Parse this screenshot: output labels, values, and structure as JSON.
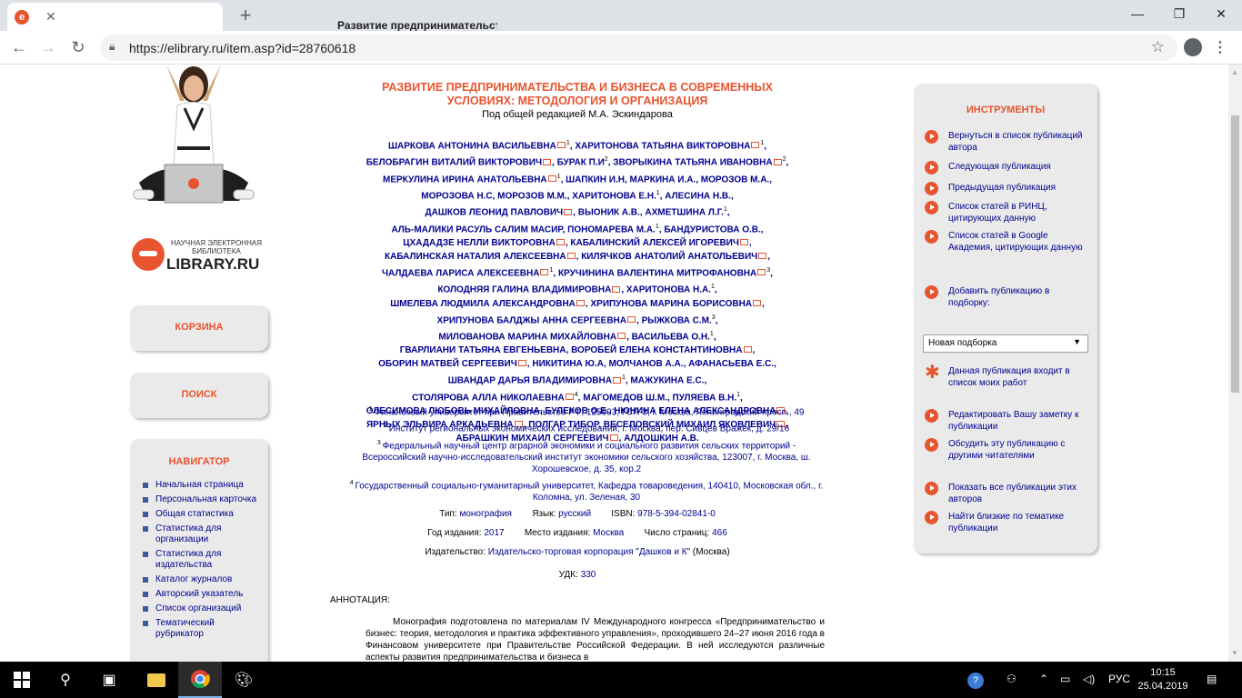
{
  "browser": {
    "tab_title": "Развитие предпринимательства",
    "url": "https://elibrary.ru/item.asp?id=28760618"
  },
  "logo": {
    "line1": "НАУЧНАЯ ЭЛЕКТРОННАЯ",
    "line2": "БИБЛИОТЕКА",
    "brand": "LIBRARY.RU"
  },
  "sidebar": {
    "cart": "КОРЗИНА",
    "search": "ПОИСК",
    "navigator": "НАВИГАТОР",
    "nav_items": [
      "Начальная страница",
      "Персональная карточка",
      "Общая статистика",
      "Статистика для организации",
      "Статистика для издательства",
      "Каталог журналов",
      "Авторский указатель",
      "Список организаций",
      "Тематический рубрикатор"
    ]
  },
  "article": {
    "title_line1": "РАЗВИТИЕ ПРЕДПРИНИМАТЕЛЬСТВА И БИЗНЕСА В СОВРЕМЕННЫХ",
    "title_line2": "УСЛОВИЯХ: МЕТОДОЛОГИЯ И ОРГАНИЗАЦИЯ",
    "editor": "Под общей редакцией М.А. Эскиндарова",
    "authors": [
      [
        "ШАРКОВА АНТОНИНА ВАСИЛЬЕВНА",
        "1",
        true
      ],
      [
        "ХАРИТОНОВА ТАТЬЯНА ВИКТОРОВНА",
        "1",
        true
      ],
      [
        "БЕЛОБРАГИН ВИТАЛИЙ ВИКТОРОВИЧ",
        "",
        true
      ],
      [
        "БУРАК П.И",
        "2",
        false
      ],
      [
        "ЗВОРЫКИНА ТАТЬЯНА ИВАНОВНА",
        "2",
        true
      ],
      [
        "МЕРКУЛИНА ИРИНА АНАТОЛЬЕВНА",
        "1",
        true
      ],
      [
        "ШАПКИН И.Н",
        "",
        false
      ],
      [
        "МАРКИНА И.А.",
        "",
        false
      ],
      [
        "МОРОЗОВ М.А.",
        "",
        false
      ],
      [
        "МОРОЗОВА Н.С",
        "",
        false
      ],
      [
        "МОРОЗОВ М.М.",
        "",
        false
      ],
      [
        "ХАРИТОНОВА Е.Н.",
        "1",
        false
      ],
      [
        "АЛЕСИНА Н.В.",
        "",
        false
      ],
      [
        "ДАШКОВ ЛЕОНИД ПАВЛОВИЧ",
        "",
        true
      ],
      [
        "ВЫОНИК А.В.",
        "",
        false
      ],
      [
        "АХМЕТШИНА Л.Г.",
        "1",
        false
      ],
      [
        "АЛЬ-МАЛИКИ РАСУЛЬ САЛИМ МАСИР",
        "",
        false
      ],
      [
        "ПОНОМАРЕВА М.А.",
        "1",
        false
      ],
      [
        "БАНДУРИСТОВА О.В.",
        "",
        false
      ],
      [
        "ЦХАДАДЗЕ НЕЛЛИ ВИКТОРОВНА",
        "",
        true
      ],
      [
        "КАБАЛИНСКИЙ АЛЕКСЕЙ ИГОРЕВИЧ",
        "",
        true
      ],
      [
        "КАБАЛИНСКАЯ НАТАЛИЯ АЛЕКСЕЕВНА",
        "",
        true
      ],
      [
        "КИЛЯЧКОВ АНАТОЛИЙ АНАТОЛЬЕВИЧ",
        "",
        true
      ],
      [
        "ЧАЛДАЕВА ЛАРИСА АЛЕКСЕЕВНА",
        "1",
        true
      ],
      [
        "КРУЧИНИНА ВАЛЕНТИНА МИТРОФАНОВНА",
        "3",
        true
      ],
      [
        "КОЛОДНЯЯ ГАЛИНА ВЛАДИМИРОВНА",
        "",
        true
      ],
      [
        "ХАРИТОНОВА Н.А.",
        "1",
        false
      ],
      [
        "ШМЕЛЕВА ЛЮДМИЛА АЛЕКСАНДРОВНА",
        "",
        true
      ],
      [
        "ХРИПУНОВА МАРИНА БОРИСОВНА",
        "",
        true
      ],
      [
        "ХРИПУНОВА БАЛДЖЫ АННА СЕРГЕЕВНА",
        "",
        true
      ],
      [
        "РЫЖКОВА С.М.",
        "3",
        false
      ],
      [
        "МИЛОВАНОВА МАРИНА МИХАЙЛОВНА",
        "",
        true
      ],
      [
        "ВАСИЛЬЕВА О.Н.",
        "1",
        false
      ],
      [
        "ГВАРЛИАНИ ТАТЬЯНА ЕВГЕНЬЕВНА",
        "",
        false
      ],
      [
        "ВОРОБЕЙ ЕЛЕНА КОНСТАНТИНОВНА",
        "",
        true
      ],
      [
        "ОБОРИН МАТВЕЙ СЕРГЕЕВИЧ",
        "",
        true
      ],
      [
        "НИКИТИНА Ю.А",
        "",
        false
      ],
      [
        "МОЛЧАНОВ А.А.",
        "",
        false
      ],
      [
        "АФАНАСЬЕВА Е.С.",
        "",
        false
      ],
      [
        "ШВАНДАР ДАРЬЯ ВЛАДИМИРОВНА",
        "1",
        true
      ],
      [
        "МАЖУКИНА Е.С.",
        "",
        false
      ],
      [
        "СТОЛЯРОВА АЛЛА НИКОЛАЕВНА",
        "4",
        true
      ],
      [
        "МАГОМЕДОВ Ш.М.",
        "",
        false
      ],
      [
        "ПУЛЯЕВА В.Н.",
        "1",
        false
      ],
      [
        "ОЛЕСИМОВА ЛЮБОВЬ МИХАЙЛОВНА",
        "",
        false
      ],
      [
        "БУЛЕКОВ О.Е.",
        "",
        false
      ],
      [
        "НЮНИНА ЕЛЕНА АЛЕКСАНДРОВНА",
        "",
        true
      ],
      [
        "ЯРНЫХ ЭЛЬВИРА АРКАДЬЕВНА",
        "",
        true
      ],
      [
        "ПОЛГАР ТИБОР",
        "",
        false
      ],
      [
        "ВЕСЕЛОВСКИЙ МИХАИЛ ЯКОВЛЕВИЧ",
        "",
        true
      ],
      [
        "АБРАШКИН МИХАИЛ СЕРГЕЕВИЧ",
        "",
        true
      ],
      [
        "АЛДОШКИН А.В.",
        "",
        false
      ]
    ],
    "affiliations": [
      {
        "n": "1",
        "text": "Финансовый университет при Правительстве РФ, 125993, ГСП-3, г. Москва, Ленинградский просп., 49"
      },
      {
        "n": "2",
        "text": "Институт региональных экономических исследований, г. Москва, пер. Сивцев Вражек, д. 29/16"
      },
      {
        "n": "3",
        "text": "Федеральный научный центр аграрной экономики и социального развития сельских территорий - Всероссийский научно-исследовательский институт экономики сельского хозяйства, 123007, г. Москва, ш. Хорошевское, д. 35, кор.2"
      },
      {
        "n": "4",
        "text": "Государственный социально-гуманитарный университет, Кафедра товароведения, 140410, Московская обл., г. Коломна, ул. Зеленая, 30"
      }
    ],
    "type_label": "Тип:",
    "type_value": "монография",
    "lang_label": "Язык:",
    "lang_value": "русский",
    "isbn_label": "ISBN:",
    "isbn_value": "978-5-394-02841-0",
    "year_label": "Год издания:",
    "year_value": "2017",
    "place_label": "Место издания:",
    "place_value": "Москва",
    "pages_label": "Число страниц:",
    "pages_value": "466",
    "publisher_label": "Издательство:",
    "publisher_value": "Издательско-торговая корпорация \"Дашков и К\"",
    "publisher_city": "(Москва)",
    "udk_label": "УДК:",
    "udk_value": "330",
    "annotation_heading": "АННОТАЦИЯ:",
    "annotation": "Монография подготовлена по материалам IV Международного конгресса «Предпринимательство и бизнес: теория, методология и практика эффективного управления», проходившего 24–27 июня 2016 года в Финансовом университете при Правительстве Российской Федерации. В ней исследуются различные аспекты развития предпринимательства и бизнеса в"
  },
  "tools": {
    "heading": "ИНСТРУМЕНТЫ",
    "items": [
      "Вернуться в список публикаций автора",
      "Следующая публикация",
      "Предыдущая публикация",
      "Список статей в РИНЦ, цитирующих данную",
      "Список статей в Google Академия, цитирующих данную",
      "Добавить публикацию в подборку:",
      "Данная публикация входит в список моих работ",
      "Редактировать Вашу заметку к публикации",
      "Обсудить эту публикацию с другими читателями",
      "Показать все публикации этих авторов",
      "Найти близкие по тематике публикации"
    ],
    "select_value": "Новая подборка"
  },
  "taskbar": {
    "lang": "РУС",
    "time": "10:15",
    "date": "25.04.2019"
  },
  "colors": {
    "accent": "#e8542f",
    "link": "#00008f"
  }
}
